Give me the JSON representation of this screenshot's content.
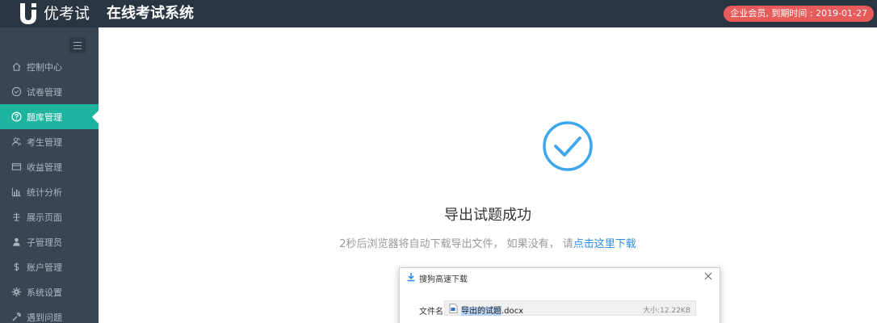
{
  "header": {
    "brand": "优考试",
    "app_title": "在线考试系统",
    "member_badge": "企业会员, 到期时间 : 2019-01-27"
  },
  "sidebar": {
    "items": [
      {
        "label": "控制中心",
        "icon": "home-icon"
      },
      {
        "label": "试卷管理",
        "icon": "check-circle-icon"
      },
      {
        "label": "题库管理",
        "icon": "question-circle-icon",
        "active": true
      },
      {
        "label": "考生管理",
        "icon": "users-icon"
      },
      {
        "label": "收益管理",
        "icon": "card-icon"
      },
      {
        "label": "统计分析",
        "icon": "bar-chart-icon"
      },
      {
        "label": "展示页面",
        "icon": "display-icon"
      },
      {
        "label": "子管理员",
        "icon": "admin-icon"
      },
      {
        "label": "账户管理",
        "icon": "dollar-icon"
      },
      {
        "label": "系统设置",
        "icon": "gear-icon"
      },
      {
        "label": "遇到问题",
        "icon": "wrench-icon"
      }
    ]
  },
  "main": {
    "success_title": "导出试题成功",
    "success_desc": "2秒后浏览器将自动下载导出文件， 如果没有， 请",
    "success_link": "点击这里下载"
  },
  "dialog": {
    "title": "搜狗高速下载",
    "file_label": "文件名",
    "file_name_selected": "导出的试题",
    "file_name_ext": ".docx",
    "file_size": "大小:12.22KB"
  },
  "colors": {
    "header_bg": "#2a3542",
    "sidebar_bg": "#3a4553",
    "active_bg": "#1fb4a0",
    "badge_bg": "#e85b5b",
    "success_blue": "#3ea6ec",
    "link_blue": "#2d8cf0"
  }
}
